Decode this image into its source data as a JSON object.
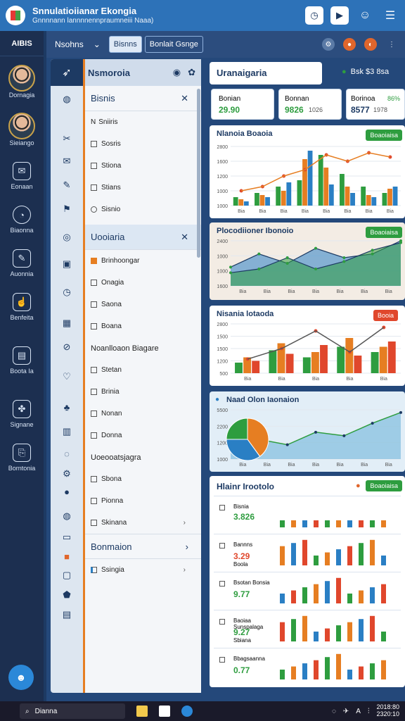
{
  "window": {
    "title": "Snnulatioiianar Ekongia",
    "subtitle": "Gnnnnann lannnnennpraumneiii Naaa)"
  },
  "rail": {
    "header": "AIBIS",
    "items": [
      {
        "label": "Dornagia",
        "icon": "person-avatar"
      },
      {
        "label": "Sieiango",
        "icon": "person-avatar"
      },
      {
        "label": "Eonaan",
        "icon": "envelope-icon"
      },
      {
        "label": "Biaonna",
        "icon": "clock-icon"
      },
      {
        "label": "Auonnia",
        "icon": "note-icon"
      },
      {
        "label": "Benfeita",
        "icon": "hand-icon"
      },
      {
        "label": "Boota Ia",
        "icon": "chart-icon"
      },
      {
        "label": "Signane",
        "icon": "handshake-icon"
      },
      {
        "label": "Borntonia",
        "icon": "document-icon"
      }
    ]
  },
  "topbar": {
    "label": "Nsohns",
    "tabs": [
      "Bisnns",
      "Bonlait Gsnge"
    ]
  },
  "nav_panel": {
    "title": "Nsmoroia",
    "section1": {
      "title": "Bisnis",
      "items": [
        "Sniiris",
        "Sosris",
        "Stiona",
        "Stians",
        "Sisnio"
      ]
    },
    "section2": {
      "title": "Uooiaria",
      "items": [
        "Brinhoongar",
        "Onagia",
        "Saona",
        "Boana",
        "Noanlloaon Biagare",
        "Stetan",
        "Brinia",
        "Nonan",
        "Donna",
        "Uoeooatsjagra",
        "Sbona",
        "Pionna",
        "Skinana"
      ]
    },
    "section3": {
      "title": "Bonmaion",
      "items": [
        "Ssingia"
      ]
    }
  },
  "header_card": {
    "title": "Uranaigaria",
    "meta": "Bsk $3 8sa"
  },
  "kpis": [
    {
      "label": "Bonian",
      "value": "29.90",
      "note": ""
    },
    {
      "label": "Bonnan",
      "value": "9826",
      "note": "1026"
    },
    {
      "label": "Borinoa",
      "value": "8577",
      "note": "1978",
      "badge": "86%"
    }
  ],
  "charts_meta": [
    {
      "title": "Nlanoia Boaoia",
      "badge": "Boaoiaisa",
      "yticks": [
        "2800",
        "1600",
        "1200",
        "1000",
        "1000"
      ],
      "xticks": [
        "Bia",
        "Bia",
        "Bia",
        "Bia",
        "Bia",
        "Bia",
        "Bia",
        "Bia"
      ]
    },
    {
      "title": "Plocodiioner Ibonoio",
      "badge": "Boaoiaisa",
      "yticks": [
        "2400",
        "1000",
        "1000",
        "1600"
      ],
      "xticks": [
        "Bia",
        "Bia",
        "Bia",
        "Bia",
        "Bia",
        "Bia",
        "Bia"
      ]
    },
    {
      "title": "Nisania lotaoda",
      "badge": "Booia",
      "yticks": [
        "2800",
        "1500",
        "1500",
        "1200",
        "500"
      ],
      "xticks": [
        "Bia",
        "Bia",
        "Bia",
        "Bia",
        "Bia"
      ]
    },
    {
      "title": "Naad Olon Iaonaion",
      "badge": "",
      "yticks": [
        "5500",
        "2200",
        "1200",
        "1000"
      ],
      "xticks": [
        "Bia",
        "Bia",
        "Bia",
        "Bia",
        "Bia",
        "Bia",
        "Bia"
      ]
    }
  ],
  "kpi_table": {
    "title": "Hlainr Irootolo",
    "badge": "Boaoiaisa",
    "rows": [
      {
        "name": "Bisnia",
        "value": "3.826",
        "sub": ""
      },
      {
        "name": "Bannns",
        "value": "3.29",
        "sub": "Boola"
      },
      {
        "name": "Bsotan Bonsia",
        "value": "9.77",
        "sub": ""
      },
      {
        "name": "Baoiaa Sunspalaga",
        "value": "9.27",
        "sub": "Sbiana"
      },
      {
        "name": "Bbagsaanna",
        "value": "0.77",
        "sub": ""
      }
    ]
  },
  "taskbar": {
    "search": "Dianna",
    "time": "2018:80",
    "date": "2320:10"
  },
  "chart_data": [
    {
      "type": "bar",
      "title": "Nlanoia Boaoia",
      "categories": [
        "Bia",
        "Bia",
        "Bia",
        "Bia",
        "Bia",
        "Bia",
        "Bia",
        "Bia"
      ],
      "series": [
        {
          "values": [
            400,
            600,
            900,
            1200,
            2400,
            1500,
            900,
            600
          ],
          "color": "#2e9d3f"
        },
        {
          "values": [
            300,
            500,
            700,
            2200,
            1800,
            900,
            500,
            800
          ],
          "color": "#e67e22"
        },
        {
          "values": [
            200,
            400,
            1100,
            2600,
            1000,
            600,
            400,
            900
          ],
          "color": "#2a7fc4"
        }
      ],
      "line": [
        700,
        900,
        1400,
        1700,
        2400,
        2100,
        2500,
        2300
      ],
      "ylim": [
        0,
        2800
      ]
    },
    {
      "type": "area",
      "title": "Plocodiioner Ibonoio",
      "x": [
        "Bia",
        "Bia",
        "Bia",
        "Bia",
        "Bia",
        "Bia",
        "Bia"
      ],
      "series": [
        {
          "values": [
            1000,
            1700,
            1200,
            2000,
            1500,
            1700,
            2400
          ],
          "color": "#2a7fc4"
        },
        {
          "values": [
            700,
            900,
            1500,
            900,
            1300,
            1900,
            2300
          ],
          "color": "#2e9d3f"
        }
      ],
      "ylim": [
        0,
        2400
      ]
    },
    {
      "type": "bar",
      "title": "Nisania lotaoda",
      "categories": [
        "Bia",
        "Bia",
        "Bia",
        "Bia",
        "Bia"
      ],
      "series": [
        {
          "values": [
            600,
            1300,
            900,
            1500,
            1200
          ],
          "color": "#2e9d3f"
        },
        {
          "values": [
            900,
            1700,
            1200,
            2000,
            1500
          ],
          "color": "#e67e22"
        },
        {
          "values": [
            700,
            1100,
            1600,
            1000,
            1800
          ],
          "color": "#e0472c"
        }
      ],
      "line": [
        800,
        1400,
        2400,
        1200,
        2600
      ],
      "ylim": [
        0,
        2800
      ]
    },
    {
      "type": "pie",
      "title": "Naad Olon Iaonaion",
      "slices": [
        {
          "value": 40,
          "color": "#e67e22"
        },
        {
          "value": 35,
          "color": "#2a7fc4"
        },
        {
          "value": 25,
          "color": "#2e9d3f"
        }
      ],
      "line": [
        1200,
        2200,
        1600,
        3000,
        2600,
        4000,
        5200
      ],
      "ylim": [
        0,
        5500
      ]
    }
  ]
}
